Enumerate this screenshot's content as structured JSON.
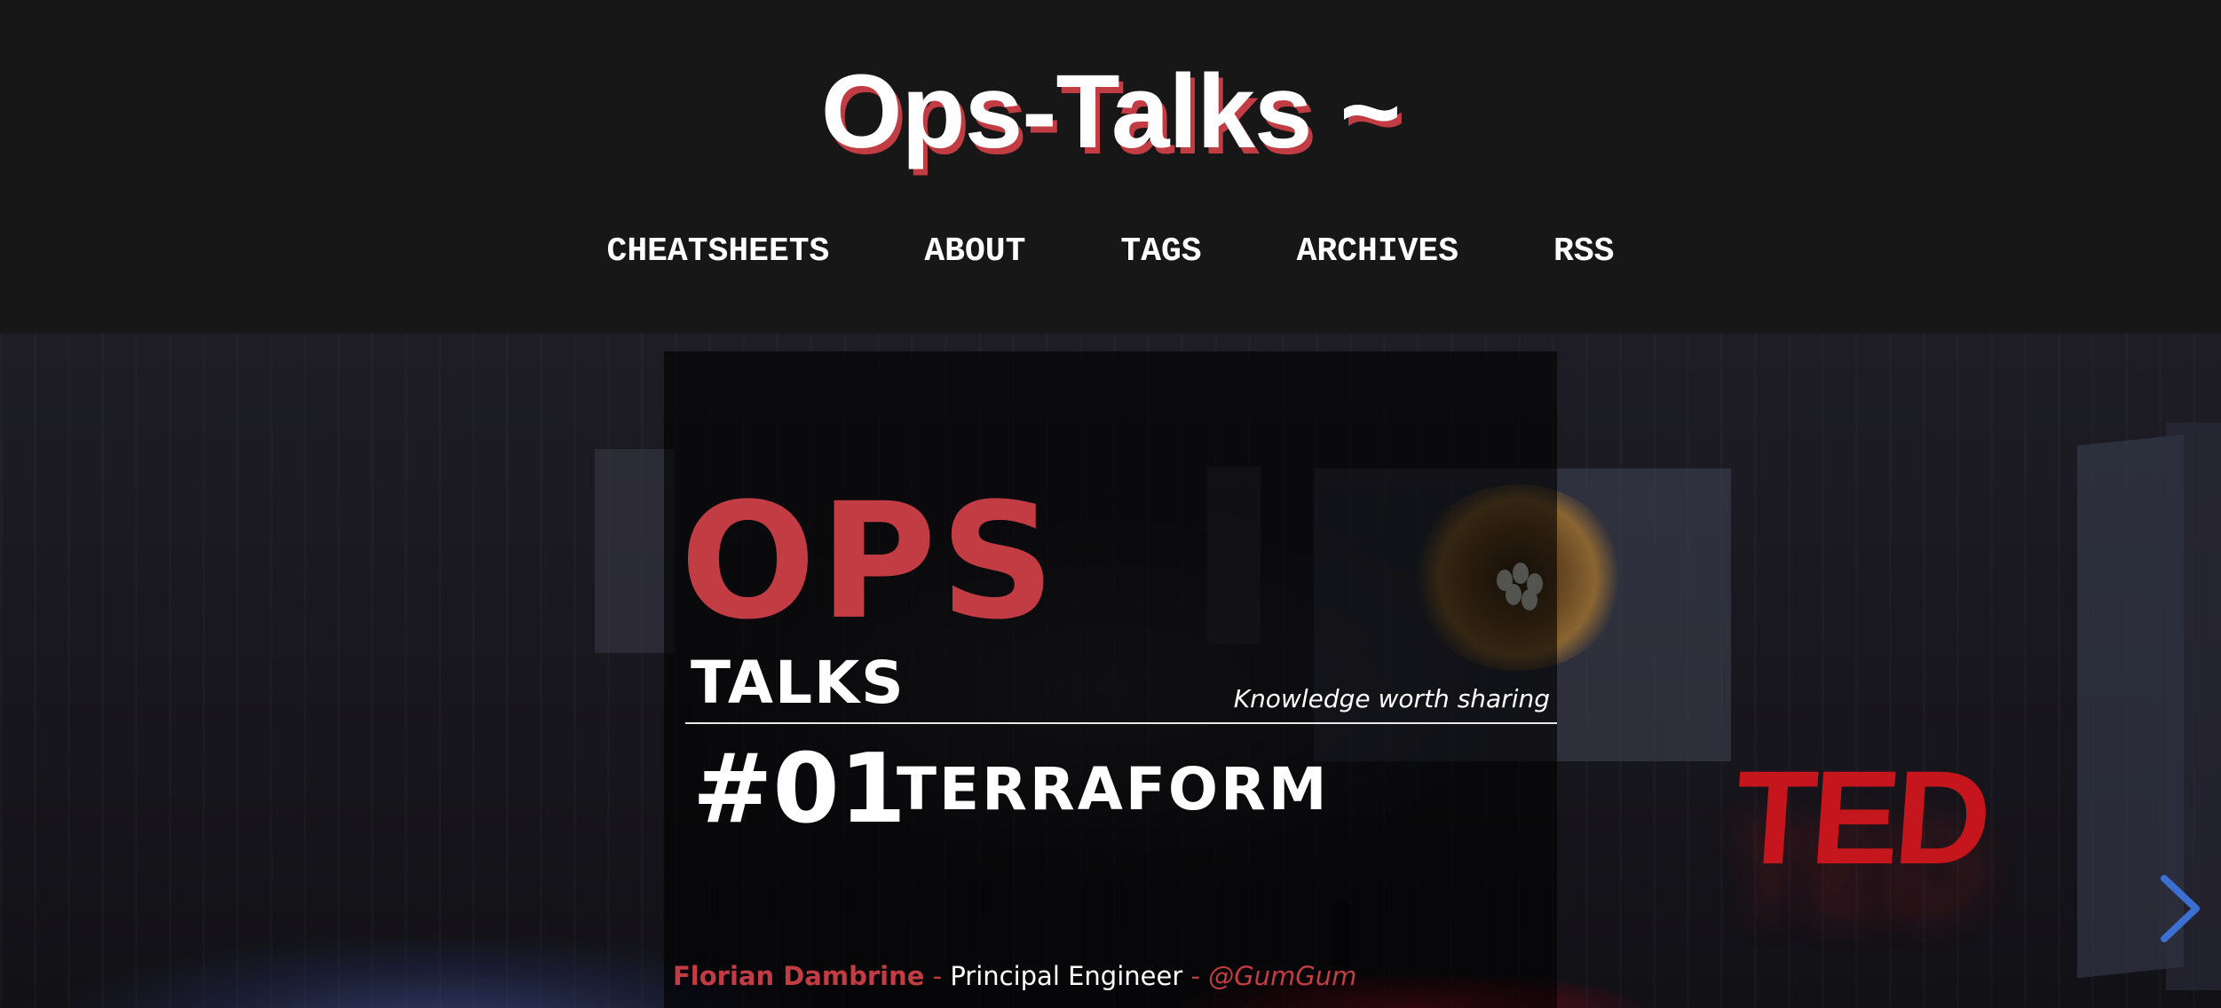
{
  "site": {
    "title": "Ops-Talks ~"
  },
  "nav": {
    "items": [
      {
        "label": "CHEATSHEETS"
      },
      {
        "label": "ABOUT"
      },
      {
        "label": "TAGS"
      },
      {
        "label": "ARCHIVES"
      },
      {
        "label": "RSS"
      }
    ]
  },
  "hero": {
    "brand_top": "OPS",
    "brand_bottom": "TALKS",
    "tagline": "Knowledge worth sharing",
    "episode_number": "#01",
    "episode_title": "TERRAFORM",
    "backdrop_logo": "TED",
    "speaker_name": "Florian Dambrine",
    "separator": " - ",
    "speaker_role": "Principal Engineer",
    "speaker_company": "@GumGum",
    "next_icon": "chevron-right-icon"
  },
  "colors": {
    "accent": "#c23c43",
    "header_bg": "#171717",
    "arrow": "#3b6fd1"
  }
}
